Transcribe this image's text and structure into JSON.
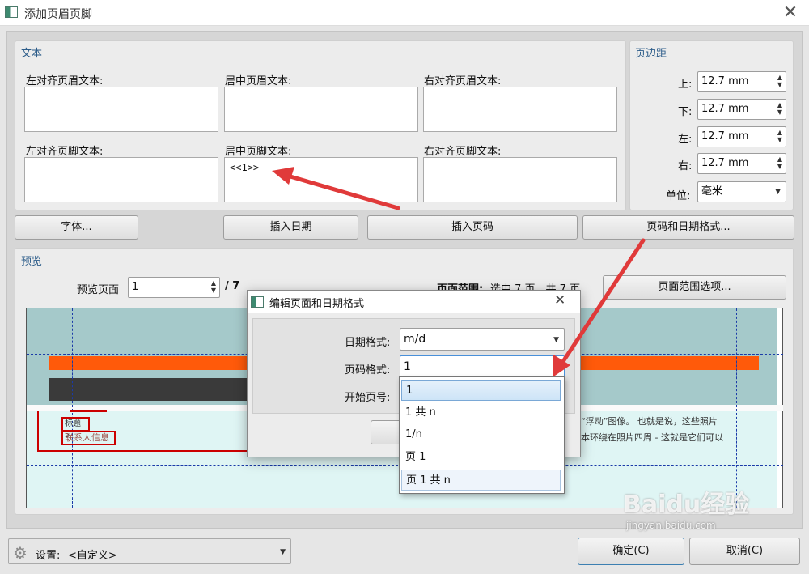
{
  "window": {
    "title": "添加页眉页脚",
    "close": "✕"
  },
  "text_group": {
    "title": "文本",
    "header_left_label": "左对齐页眉文本:",
    "header_center_label": "居中页眉文本:",
    "header_right_label": "右对齐页眉文本:",
    "footer_left_label": "左对齐页脚文本:",
    "footer_center_label": "居中页脚文本:",
    "footer_right_label": "右对齐页脚文本:",
    "footer_center_value": "<<1>>"
  },
  "margin_group": {
    "title": "页边距",
    "top_label": "上:",
    "top_value": "12.7 mm",
    "bottom_label": "下:",
    "bottom_value": "12.7 mm",
    "left_label": "左:",
    "left_value": "12.7 mm",
    "right_label": "右:",
    "right_value": "12.7 mm",
    "unit_label": "单位:",
    "unit_value": "毫米"
  },
  "buttons": {
    "font": "字体...",
    "insert_date": "插入日期",
    "insert_page": "插入页码",
    "page_date_format": "页码和日期格式...",
    "page_range_options": "页面范围选项...",
    "ok": "确定(C)",
    "cancel": "取消(C)"
  },
  "preview_group": {
    "title": "预览",
    "page_label": "预览页面",
    "page_value": "1",
    "page_total": "/ 7",
    "range_label": "页面范围:",
    "range_text": "选中 7 页，共 7 页"
  },
  "preview_content": {
    "heading": "标题 5",
    "contact": "联系人信息",
    "body_line1": "“浮动”图像。 也就是说，这些照片",
    "body_line2": "本环绕在照片四周 - 这就是它们可以"
  },
  "dialog": {
    "title": "编辑页面和日期格式",
    "close": "✕",
    "date_format_label": "日期格式:",
    "date_format_value": "m/d",
    "page_format_label": "页码格式:",
    "page_format_value": "1",
    "start_page_label": "开始页号:"
  },
  "dropdown": {
    "options": [
      "1",
      "1 共 n",
      "1/n",
      "页 1",
      "页 1 共 n"
    ]
  },
  "settings": {
    "label": "设置:",
    "value": "<自定义>"
  },
  "watermark": {
    "brand": "Baidu经验",
    "url": "jingyan.baidu.com"
  }
}
